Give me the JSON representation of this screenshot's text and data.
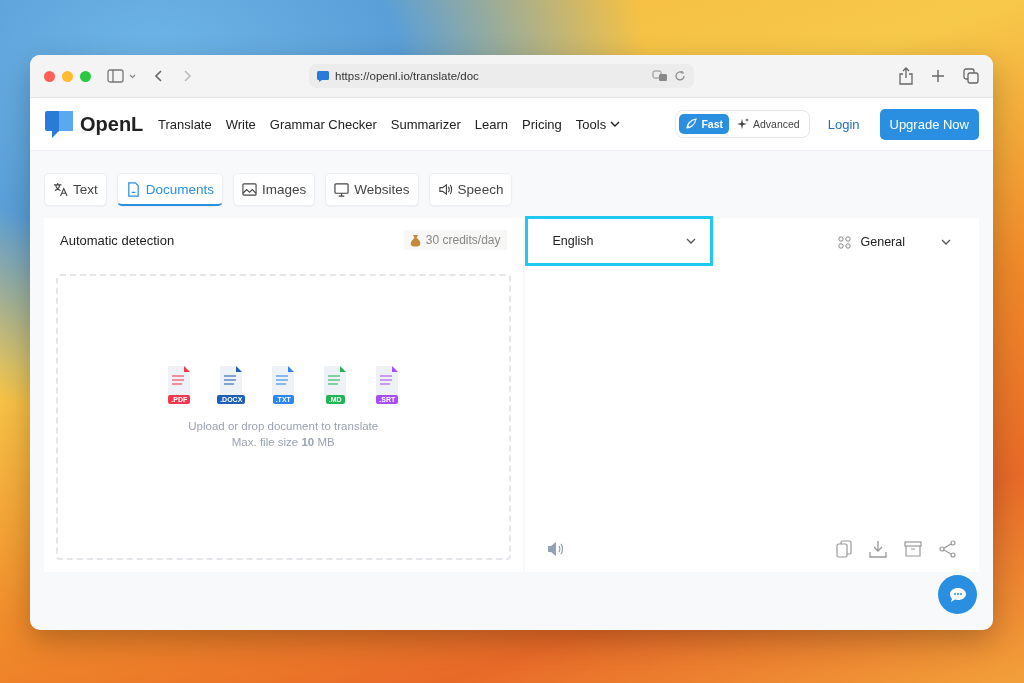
{
  "browser": {
    "url": "https://openl.io/translate/doc"
  },
  "header": {
    "brand": "OpenL",
    "nav": [
      {
        "label": "Translate",
        "dropdown": false
      },
      {
        "label": "Write",
        "dropdown": false
      },
      {
        "label": "Grammar Checker",
        "dropdown": false
      },
      {
        "label": "Summarizer",
        "dropdown": false
      },
      {
        "label": "Learn",
        "dropdown": false
      },
      {
        "label": "Pricing",
        "dropdown": false
      },
      {
        "label": "Tools",
        "dropdown": true
      }
    ],
    "modes": [
      {
        "label": "Fast",
        "selected": true
      },
      {
        "label": "Advanced",
        "selected": false
      }
    ],
    "login": "Login",
    "upgrade": "Upgrade Now"
  },
  "tabs": [
    {
      "label": "Text",
      "kind": "translate",
      "selected": false
    },
    {
      "label": "Documents",
      "kind": "document",
      "selected": true
    },
    {
      "label": "Images",
      "kind": "image",
      "selected": false
    },
    {
      "label": "Websites",
      "kind": "monitor",
      "selected": false
    },
    {
      "label": "Speech",
      "kind": "speaker",
      "selected": false
    }
  ],
  "source": {
    "language": "Automatic detection",
    "credits": "30 credits/day",
    "file_types": [
      {
        "label": ".PDF",
        "color": "#f0384f"
      },
      {
        "label": ".DOCX",
        "color": "#1f5fb5"
      },
      {
        "label": ".TXT",
        "color": "#2b86f0"
      },
      {
        "label": ".MD",
        "color": "#22b455"
      },
      {
        "label": ".SRT",
        "color": "#a64ef0"
      }
    ],
    "hint": "Upload or drop document to translate",
    "limit": "Max. file size **10** MB"
  },
  "target": {
    "language": "English",
    "highlighted": true,
    "domain": "General"
  }
}
